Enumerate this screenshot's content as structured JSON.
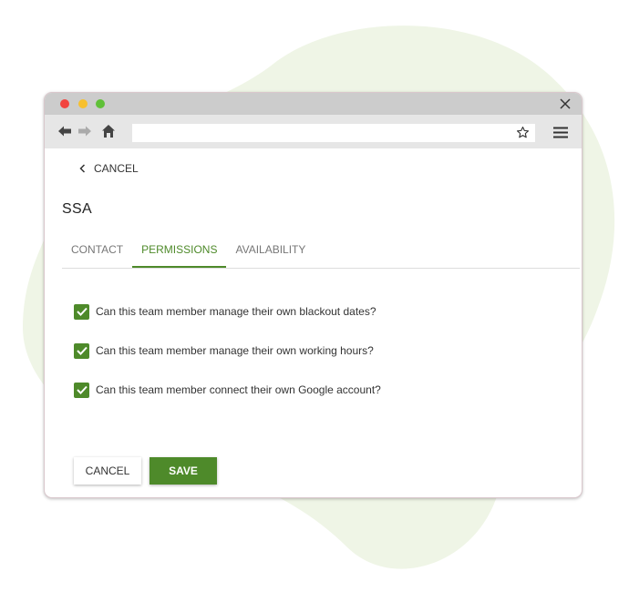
{
  "colors": {
    "accent": "#4e8a2a",
    "blob": "#eff5e6",
    "titlebar": "#cccccc",
    "toolbar": "#e6e6e6"
  },
  "browser": {
    "address_value": "",
    "icons": [
      "back-arrow-icon",
      "forward-arrow-icon",
      "home-icon",
      "star-icon",
      "hamburger-menu-icon",
      "close-icon"
    ]
  },
  "back_link": {
    "label": "CANCEL",
    "icon": "chevron-left-icon"
  },
  "page": {
    "title": "SSA"
  },
  "tabs": [
    {
      "label": "CONTACT",
      "active": false
    },
    {
      "label": "PERMISSIONS",
      "active": true
    },
    {
      "label": "AVAILABILITY",
      "active": false
    }
  ],
  "permissions": [
    {
      "label": "Can this team member manage their own blackout dates?",
      "checked": true
    },
    {
      "label": "Can this team member manage their own working hours?",
      "checked": true
    },
    {
      "label": "Can this team member connect their own Google account?",
      "checked": true
    }
  ],
  "actions": {
    "cancel_label": "CANCEL",
    "save_label": "SAVE"
  }
}
